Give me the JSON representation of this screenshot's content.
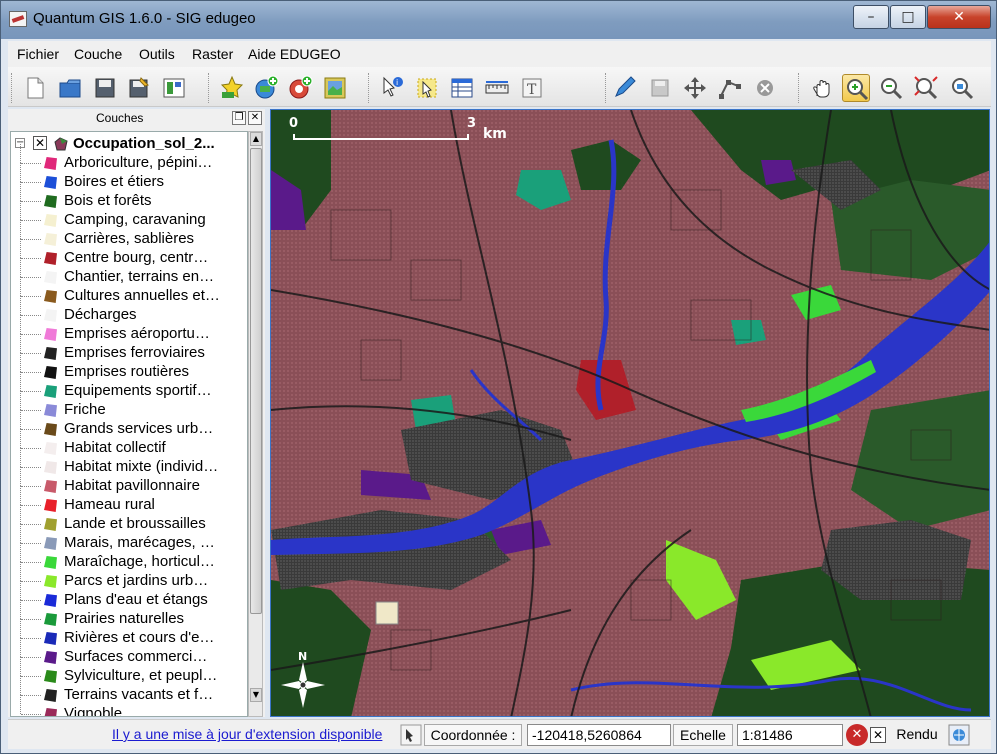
{
  "window": {
    "title": "Quantum GIS 1.6.0 - SIG edugeo",
    "minimize_glyph": "–",
    "maximize_glyph": "□",
    "close_glyph": "✕"
  },
  "menu": [
    "Fichier",
    "Couche",
    "Outils",
    "Raster",
    "Aide EDUGEO"
  ],
  "toolbar": {
    "icons": [
      "new-project-icon",
      "open-project-icon",
      "save-project-icon",
      "save-as-icon",
      "print-composer-icon",
      "add-vector-layer-icon",
      "add-raster-layer-icon",
      "add-postgis-layer-icon",
      "add-wms-layer-icon",
      "identify-icon",
      "select-features-icon",
      "attribute-table-icon",
      "measure-line-icon",
      "text-annotation-icon",
      "toggle-editing-icon",
      "save-edits-icon",
      "move-feature-icon",
      "node-tool-icon",
      "delete-selected-icon",
      "pan-icon",
      "zoom-in-icon",
      "zoom-out-icon",
      "zoom-full-icon",
      "zoom-layer-icon"
    ]
  },
  "layers_panel": {
    "title": "Couches",
    "float_glyph": "❐",
    "close_glyph": "✕",
    "expand_glyph": "−",
    "root_check": "✕",
    "layer_name": "Occupation_sol_2...",
    "scroll_up": "▲",
    "scroll_down": "▼",
    "categories": [
      {
        "label": "Arboriculture, pépini…",
        "color": "#e0287a"
      },
      {
        "label": "Boires et étiers",
        "color": "#1c4fd8"
      },
      {
        "label": "Bois et forêts",
        "color": "#1f6b1f"
      },
      {
        "label": "Camping, caravaning",
        "color": "#f5f0d0"
      },
      {
        "label": "Carrières, sablières",
        "color": "#f5f0d8"
      },
      {
        "label": "Centre bourg, centr…",
        "color": "#b0202a"
      },
      {
        "label": "Chantier, terrains en…",
        "color": "#f4f4f4"
      },
      {
        "label": "Cultures annuelles et…",
        "color": "#8a5a1e"
      },
      {
        "label": "Décharges",
        "color": "#f4f4f4"
      },
      {
        "label": "Emprises aéroportu…",
        "color": "#f07ad8"
      },
      {
        "label": "Emprises ferroviaires",
        "color": "#222222"
      },
      {
        "label": "Emprises routières",
        "color": "#111111"
      },
      {
        "label": "Equipements sportif…",
        "color": "#1aa07a"
      },
      {
        "label": "Friche",
        "color": "#8a8ad8"
      },
      {
        "label": "Grands services urb…",
        "color": "#6a4a1a"
      },
      {
        "label": "Habitat collectif",
        "color": "#f4eeee"
      },
      {
        "label": "Habitat mixte (individ…",
        "color": "#f0e8e8"
      },
      {
        "label": "Habitat pavillonnaire",
        "color": "#c85a6a"
      },
      {
        "label": "Hameau rural",
        "color": "#e8202a"
      },
      {
        "label": "Lande et broussailles",
        "color": "#a0a030"
      },
      {
        "label": "Marais, marécages, …",
        "color": "#8a9ab8"
      },
      {
        "label": "Maraîchage, horticul…",
        "color": "#3ad83a"
      },
      {
        "label": "Parcs et jardins urb…",
        "color": "#8ae82a"
      },
      {
        "label": "Plans d'eau et étangs",
        "color": "#1a2ad8"
      },
      {
        "label": "Prairies naturelles",
        "color": "#1a9a3a"
      },
      {
        "label": "Rivières et cours d'e…",
        "color": "#1a2ab8"
      },
      {
        "label": "Surfaces commerci…",
        "color": "#5a1a8a"
      },
      {
        "label": "Sylviculture, et peupl…",
        "color": "#2a8a1a"
      },
      {
        "label": "Terrains vacants et f…",
        "color": "#222222"
      },
      {
        "label": "Vignoble",
        "color": "#9a2a5a"
      }
    ]
  },
  "map": {
    "scale_start": "0",
    "scale_end": "3",
    "scale_unit": "km",
    "north": "N",
    "colors": {
      "urban": "#8a4f57",
      "river": "#2a35c8",
      "forest": "#1f4a1f",
      "road": "#1a1a1a"
    }
  },
  "statusbar": {
    "update_link": "Il y a une mise à jour d'extension disponible",
    "coord_label": "Coordonnée :",
    "coord_value": "-120418,5260864",
    "scale_label": "Echelle",
    "scale_value": "1:81486",
    "stop_glyph": "✕",
    "render_check": "✕",
    "render_label": "Rendu"
  }
}
